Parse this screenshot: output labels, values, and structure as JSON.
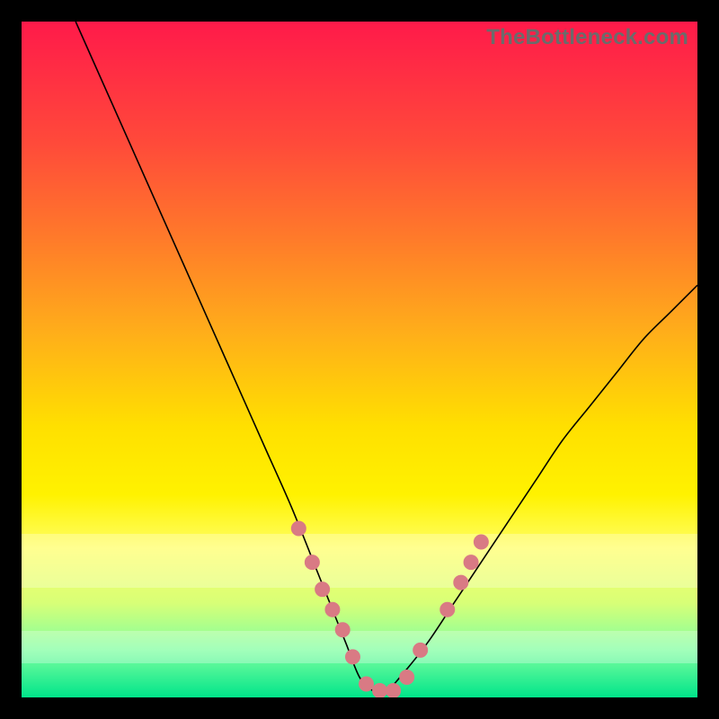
{
  "watermark": {
    "text": "TheBottleneck.com"
  },
  "colors": {
    "frame": "#000000",
    "dot": "#d97a84",
    "curve": "#000000",
    "gradient_top": "#ff1a4a",
    "gradient_bottom": "#00e58a"
  },
  "chart_data": {
    "type": "line",
    "title": "",
    "xlabel": "",
    "ylabel": "",
    "xlim": [
      0,
      100
    ],
    "ylim": [
      0,
      100
    ],
    "grid": false,
    "legend": false,
    "series": [
      {
        "name": "bottleneck-curve",
        "x": [
          8,
          12,
          16,
          20,
          24,
          28,
          32,
          36,
          40,
          44,
          46,
          48,
          50,
          52,
          54,
          56,
          60,
          64,
          68,
          72,
          76,
          80,
          84,
          88,
          92,
          96,
          100
        ],
        "y": [
          100,
          91,
          82,
          73,
          64,
          55,
          46,
          37,
          28,
          18,
          13,
          8,
          3,
          1,
          1,
          3,
          8,
          14,
          20,
          26,
          32,
          38,
          43,
          48,
          53,
          57,
          61
        ]
      }
    ],
    "highlight_points": {
      "name": "dots",
      "x": [
        41,
        43,
        44.5,
        46,
        47.5,
        49,
        51,
        53,
        55,
        57,
        59,
        63,
        65,
        66.5,
        68
      ],
      "y": [
        25,
        20,
        16,
        13,
        10,
        6,
        2,
        1,
        1,
        3,
        7,
        13,
        17,
        20,
        23
      ]
    },
    "pale_bands": [
      {
        "y0": 76,
        "y1": 84
      },
      {
        "y0": 90,
        "y1": 95
      }
    ]
  }
}
